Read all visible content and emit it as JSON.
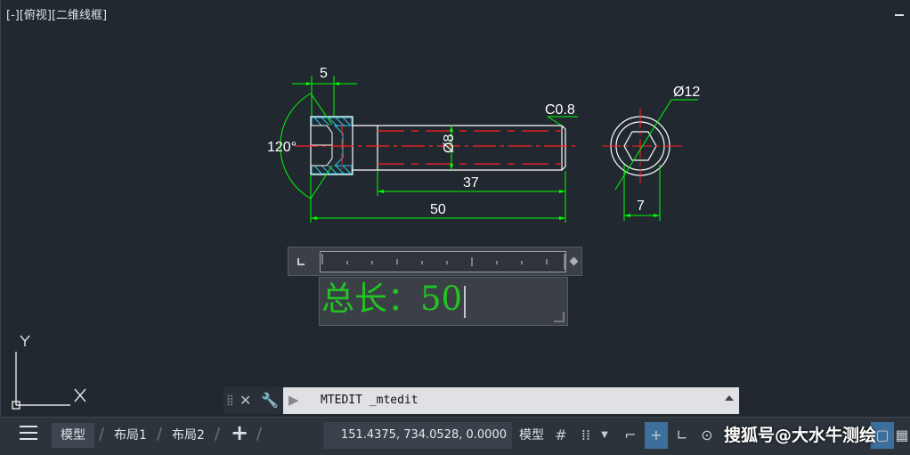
{
  "viewport": {
    "label": "[-][俯视][二维线框]"
  },
  "drawing": {
    "dim_top": "5",
    "dim_angle": "120°",
    "dim_diameter": "Ø8",
    "dim_chamfer": "C0.8",
    "dim_thread": "37",
    "dim_total": "50",
    "dim_circle": "Ø12",
    "dim_hex": "7",
    "ucs_x": "X",
    "ucs_y": "Y"
  },
  "mtext": {
    "content": "总长：50"
  },
  "command": {
    "text": "MTEDIT _mtedit"
  },
  "status": {
    "tabs": [
      "模型",
      "布局1",
      "布局2"
    ],
    "add_tab": "+",
    "coords": "151.4375, 734.0528, 0.0000",
    "model_button": "模型"
  },
  "watermark": "搜狐号@大水牛测绘",
  "colors": {
    "background": "#212830",
    "dimension": "#00ff00",
    "centerline": "#ff2020",
    "hatch": "#2ec4e0",
    "mtext": "#21c421"
  }
}
